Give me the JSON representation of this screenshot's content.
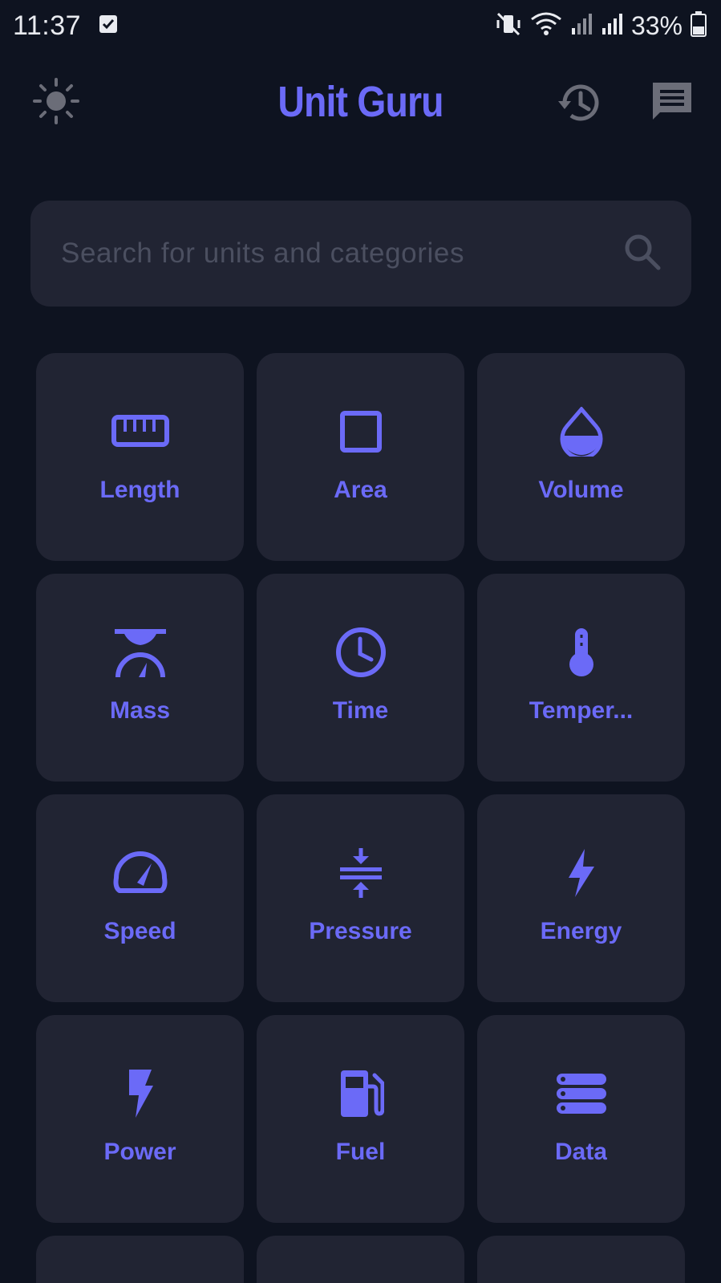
{
  "status_bar": {
    "time": "11:37",
    "battery": "33%"
  },
  "app": {
    "title": "Unit Guru",
    "accent": "#6b6af7",
    "background": "#0e1320",
    "surface": "#212433"
  },
  "search": {
    "placeholder": "Search for units and categories",
    "value": ""
  },
  "categories": [
    {
      "label": "Length",
      "icon": "ruler-icon"
    },
    {
      "label": "Area",
      "icon": "square-icon"
    },
    {
      "label": "Volume",
      "icon": "drop-icon"
    },
    {
      "label": "Mass",
      "icon": "scale-icon"
    },
    {
      "label": "Time",
      "icon": "clock-icon"
    },
    {
      "label": "Temper...",
      "icon": "thermometer-icon"
    },
    {
      "label": "Speed",
      "icon": "speedometer-icon"
    },
    {
      "label": "Pressure",
      "icon": "compress-icon"
    },
    {
      "label": "Energy",
      "icon": "lightning-icon"
    },
    {
      "label": "Power",
      "icon": "power-bolt-icon"
    },
    {
      "label": "Fuel",
      "icon": "fuel-pump-icon"
    },
    {
      "label": "Data",
      "icon": "storage-icon"
    }
  ]
}
